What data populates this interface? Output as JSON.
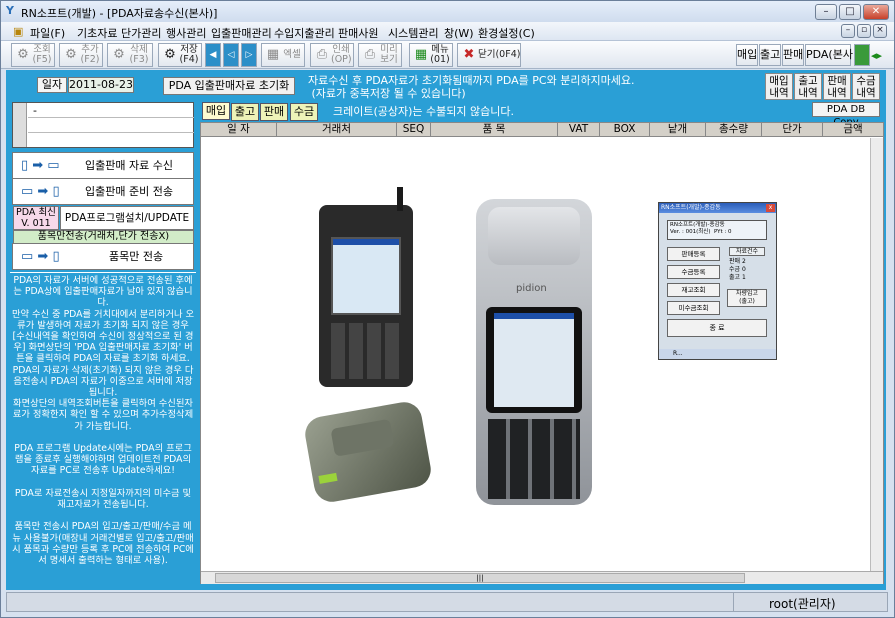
{
  "window": {
    "title": "RN소프트(개발) - [PDA자료송수신(본사)]",
    "controls": [
      "–",
      "□",
      "✕"
    ],
    "child_controls": [
      "–",
      "▫",
      "×"
    ]
  },
  "menu": [
    "파일(F)",
    "기초자료",
    "단가관리",
    "행사관리",
    "입출판매관리",
    "수입지출관리",
    "판매사원",
    "시스템관리",
    "창(W)",
    "환경설정(C)"
  ],
  "toolbar": {
    "find": {
      "label": "조회\n(F5)",
      "icon": "search-icon"
    },
    "add": {
      "label": "추가\n(F2)",
      "icon": "gear-icon"
    },
    "delete": {
      "label": "삭제\n(F3)",
      "icon": "gear-icon"
    },
    "save": {
      "label": "저장\n(F4)",
      "icon": "save-icon"
    },
    "excel": {
      "label": "엑셀"
    },
    "print": {
      "label": "인쇄\n(OP)"
    },
    "preview": {
      "label": "미리\n보기"
    },
    "menu_btn": {
      "label": "메뉴\n(01)"
    },
    "close": {
      "label": "닫기(0F4)"
    },
    "right": [
      "매입",
      "출고",
      "판매",
      "PDA(본사)"
    ]
  },
  "header": {
    "date_label": "일자",
    "date_value": "2011-08-23",
    "init_button": "PDA 입출판매자료 초기화",
    "notice": "자료수신 후 PDA자료가 초기화됨때까지 PDA를 PC와 분리하지마세요.\n (자료가 중복저장 될 수 있습니다)",
    "history_buttons": [
      "매입\n내역",
      "출고\n내역",
      "판매\n내역",
      "수금\n내역"
    ]
  },
  "left": {
    "list_first": "-",
    "btn_receive": "입출판매 자료 수신",
    "btn_prepare": "입출판매 준비 전송",
    "pda_latest_label": "PDA 최신",
    "pda_version": "V. 011",
    "btn_install": "PDA프로그램설치/UPDATE",
    "item_only_caption": "품목만전송(거래처,단가 전송X)",
    "btn_item_only": "품목만 전송",
    "help": "PDA의 자료가 서버에 성공적으로 전송된 후에는 PDA상에 입출판매자료가 남아 있지 않습니다.\n만약 수신 중 PDA를 거치대에서 분리하거나 오류가 발생하여 자료가 초기화 되지 않은 경우 [수신내역을 확인하여 수신이 정상적으로 된 경우] 화면상단의 'PDA 입출판매자료 초기화' 버튼을 클릭하여 PDA의 자료를 초기화 하세요.\nPDA의 자료가 삭제(초기화) 되지 않은 경우 다음전송시 PDA의 자료가 이중으로 서버에 저장됩니다.\n화면상단의 내역조회버튼을 클릭하여 수신된자료가 정확한지 확인 할 수 있으며 추가수정삭제가 가능합니다.\n\nPDA 프로그램 Update시에는 PDA의 프로그램을 종료후 실행해야하며 업데이트전 PDA의 자료를 PC로 전송후 Update하세요!\n\nPDA로 자료전송시 지정일자까지의 미수금 및 재고자료가 전송됩니다.\n\n품목만 전송시 PDA의 입고/출고/판매/수금 메뉴 사용불가(매장내 거래건별로 입고/출고/판매시 품목과 수량만 등록 후 PC에 전송하여 PC에서 명세서 출력하는 형태로 사용)."
  },
  "tabs": [
    "매입",
    "출고",
    "판매",
    "수금"
  ],
  "tab_notice": "크레이트(공상자)는 수불되지 않습니다.",
  "pda_db_copy": "PDA DB Copy",
  "grid_columns": [
    "일 자",
    "거래처",
    "SEQ",
    "품 목",
    "VAT",
    "BOX",
    "낱개",
    "총수량",
    "단가",
    "금액"
  ],
  "device_screen": {
    "title": "RN소프트(개발)-종감동",
    "header": "RN소프트(개발)-종감동\nVer. : 001(최신)  PYt : 0",
    "buttons": [
      "판매등록",
      "수금등록",
      "재고조회",
      "미수금조회"
    ],
    "stats_title": "자료건수",
    "stats": [
      "판매 2",
      "수금 0",
      "출고 1"
    ],
    "side_button": "차량입고\n(출고)",
    "close": "종 료",
    "taskbar": "R..."
  },
  "device_brand": "pidion",
  "status": {
    "user": "root(관리자)"
  },
  "scroll_mark": "|||"
}
